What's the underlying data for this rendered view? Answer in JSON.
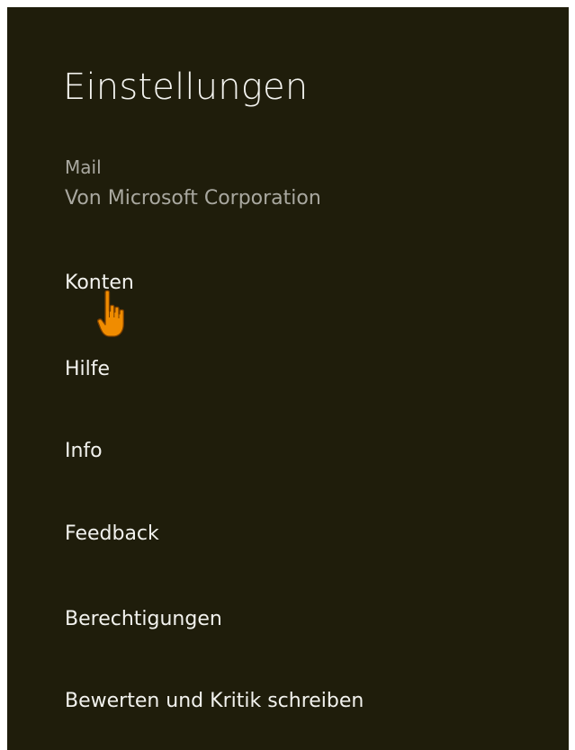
{
  "settings": {
    "title": "Einstellungen",
    "app_name": "Mail",
    "publisher": "Von Microsoft Corporation",
    "items": [
      {
        "label": "Konten"
      },
      {
        "label": "Hilfe"
      },
      {
        "label": "Info"
      },
      {
        "label": "Feedback"
      },
      {
        "label": "Berechtigungen"
      },
      {
        "label": "Bewerten und Kritik schreiben"
      }
    ]
  },
  "colors": {
    "panel_background": "#1f1d0b",
    "text": "#f2f2ee",
    "secondary_text": "#a9a8a0",
    "cursor": "#f08c00"
  },
  "cursor": {
    "icon": "hand-pointer-icon"
  }
}
